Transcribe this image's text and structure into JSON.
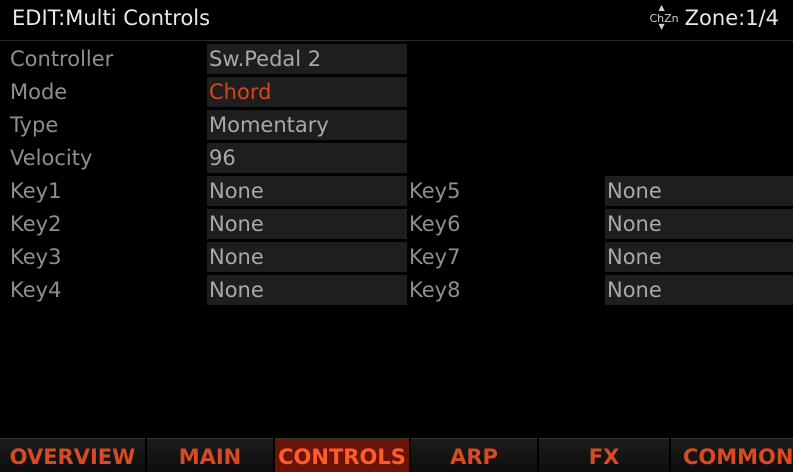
{
  "header": {
    "title": "EDIT:Multi Controls",
    "zone_icon_label": "ChZn",
    "zone_label": "Zone:1/4"
  },
  "params": {
    "controller": {
      "label": "Controller",
      "value": "Sw.Pedal 2"
    },
    "mode": {
      "label": "Mode",
      "value": "Chord"
    },
    "type": {
      "label": "Type",
      "value": "Momentary"
    },
    "velocity": {
      "label": "Velocity",
      "value": "96"
    }
  },
  "keys": [
    {
      "label": "Key1",
      "value": "None"
    },
    {
      "label": "Key2",
      "value": "None"
    },
    {
      "label": "Key3",
      "value": "None"
    },
    {
      "label": "Key4",
      "value": "None"
    },
    {
      "label": "Key5",
      "value": "None"
    },
    {
      "label": "Key6",
      "value": "None"
    },
    {
      "label": "Key7",
      "value": "None"
    },
    {
      "label": "Key8",
      "value": "None"
    }
  ],
  "tabs": [
    {
      "label": "OVERVIEW"
    },
    {
      "label": "MAIN"
    },
    {
      "label": "CONTROLS",
      "selected": true
    },
    {
      "label": "ARP"
    },
    {
      "label": "FX"
    },
    {
      "label": "COMMON"
    }
  ],
  "colors": {
    "accent": "#d94a22",
    "selected_tab_bg": "#6a1407",
    "field_bg": "#1e1e1e",
    "active_value": "#d8441c"
  }
}
